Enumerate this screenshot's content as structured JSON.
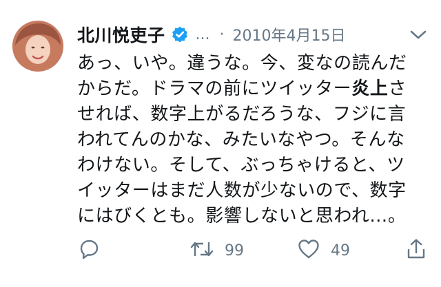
{
  "tweet": {
    "author_name": "北川悦吏子",
    "handle": "...",
    "separator": "·",
    "date": "2010年4月15日",
    "text_lines": [
      {
        "before": "あっ、いや。違うな。今、変なの読んだ",
        "bold": "",
        "after": ""
      },
      {
        "before": "からだ。ドラマの前にツイッター",
        "bold": "炎上",
        "after": "さ"
      },
      {
        "before": "せれば、数字上がるだろうな、フジに言",
        "bold": "",
        "after": ""
      },
      {
        "before": "われてんのかな、みたいなやつ。そんな",
        "bold": "",
        "after": ""
      },
      {
        "before": "わけない。そして、ぶっちゃけると、ツ",
        "bold": "",
        "after": ""
      },
      {
        "before": "イッターはまだ人数が少ないので、数字",
        "bold": "",
        "after": ""
      },
      {
        "before": "にはびくとも。影響しないと思われ…。",
        "bold": "",
        "after": ""
      }
    ],
    "retweet_count": "99",
    "like_count": "49"
  },
  "icons": {
    "avatar": "avatar",
    "verified": "verified-badge-icon",
    "menu": "chevron-down-icon",
    "reply": "reply-icon",
    "retweet": "retweet-icon",
    "like": "heart-icon",
    "share": "share-icon"
  },
  "colors": {
    "text": "#14171a",
    "secondary": "#657786",
    "verified": "#1da1f2"
  }
}
